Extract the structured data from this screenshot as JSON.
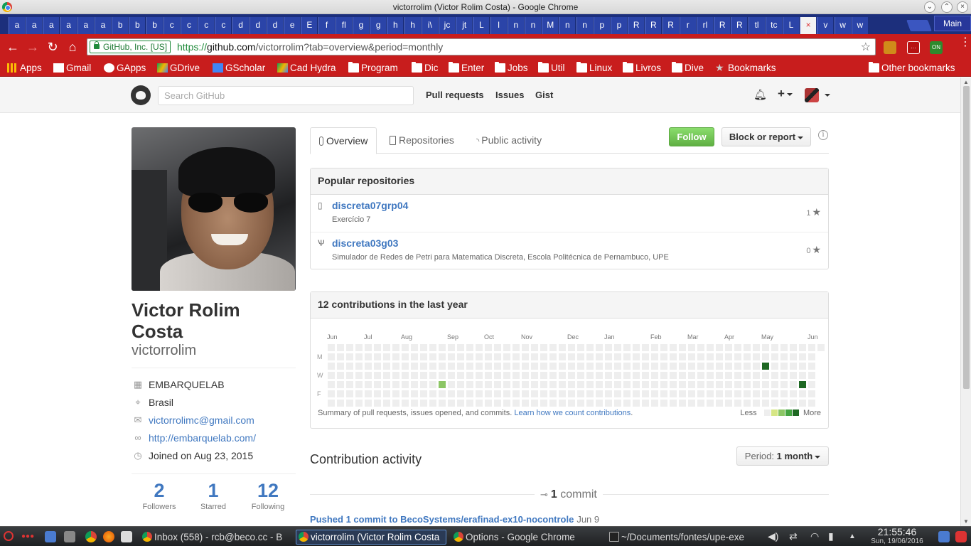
{
  "window": {
    "title": "victorrolim (Victor Rolim Costa) - Google Chrome"
  },
  "tabs": {
    "labels": [
      "a",
      "a",
      "a",
      "a",
      "a",
      "a",
      "b",
      "b",
      "b",
      "c",
      "c",
      "c",
      "c",
      "d",
      "d",
      "d",
      "e",
      "E",
      "f",
      "fl",
      "g",
      "g",
      "h",
      "h",
      "i\\",
      "jc",
      "jt",
      "L",
      "l",
      "n",
      "n",
      "M",
      "n",
      "n",
      "p",
      "p",
      "R",
      "R",
      "R",
      "r",
      "rl",
      "R",
      "R",
      "tl",
      "tc",
      "L",
      "×",
      "v",
      "w",
      "w"
    ],
    "active_index": 46,
    "profile_label": "Main"
  },
  "address_bar": {
    "ev_label": "GitHub, Inc. [US]",
    "url_protocol": "https://",
    "url_host": "github.com",
    "url_path": "/victorrolim?tab=overview&period=monthly"
  },
  "bookmarks": {
    "items": [
      "Apps",
      "Gmail",
      "GApps",
      "GDrive",
      "GScholar",
      "Cad Hydra",
      "Program",
      "Dic",
      "Enter",
      "Jobs",
      "Util",
      "Linux",
      "Livros",
      "Dive",
      "Bookmarks"
    ],
    "other": "Other bookmarks"
  },
  "github_header": {
    "search_placeholder": "Search GitHub",
    "nav": [
      "Pull requests",
      "Issues",
      "Gist"
    ]
  },
  "profile": {
    "fullname": "Victor Rolim Costa",
    "username": "victorrolim",
    "organization": "EMBARQUELAB",
    "location": "Brasil",
    "email": "victorrolimc@gmail.com",
    "website": "http://embarquelab.com/",
    "joined": "Joined on Aug 23, 2015",
    "stats": [
      {
        "value": "2",
        "label": "Followers"
      },
      {
        "value": "1",
        "label": "Starred"
      },
      {
        "value": "12",
        "label": "Following"
      }
    ]
  },
  "profile_tabs": [
    "Overview",
    "Repositories",
    "Public activity"
  ],
  "actions": {
    "follow": "Follow",
    "block": "Block or report"
  },
  "popular_repos": {
    "title": "Popular repositories",
    "items": [
      {
        "name": "discreta07grp04",
        "description": "Exercício 7",
        "stars": "1",
        "icon": "repo-icon"
      },
      {
        "name": "discreta03g03",
        "description": "Simulador de Redes de Petri para Matematica Discreta, Escola Politécnica de Pernambuco, UPE",
        "stars": "0",
        "icon": "fork-icon"
      }
    ]
  },
  "contributions": {
    "title": "12 contributions in the last year",
    "months": [
      "Jun",
      "Jul",
      "Aug",
      "Sep",
      "Oct",
      "Nov",
      "Dec",
      "Jan",
      "Feb",
      "Mar",
      "Apr",
      "May",
      "Jun"
    ],
    "days": [
      "M",
      "W",
      "F"
    ],
    "summary_text": "Summary of pull requests, issues opened, and commits.",
    "summary_link": "Learn how we count contributions",
    "legend_less": "Less",
    "legend_more": "More",
    "colors": [
      "#eeeeee",
      "#d6e685",
      "#8cc665",
      "#44a340",
      "#1e6823"
    ]
  },
  "contribution_activity": {
    "title": "Contribution activity",
    "period_label": "Period:",
    "period_value": "1 month",
    "commit_count": "1",
    "commit_word": "commit",
    "pushed_text": "Pushed 1 commit to BecoSystems/erafinad-ex10-nocontrole",
    "pushed_date": "Jun 9"
  },
  "taskbar": {
    "tasks": [
      {
        "label": "Inbox (558) - rcb@beco.cc - B",
        "type": "chrome"
      },
      {
        "label": "victorrolim (Victor Rolim Costa",
        "type": "chrome"
      },
      {
        "label": "Options - Google Chrome",
        "type": "chrome"
      },
      {
        "label": "~/Documents/fontes/upe-exe",
        "type": "terminal"
      }
    ],
    "active_task": 1,
    "time": "21:55:46",
    "date": "Sun, 19/06/2016"
  }
}
